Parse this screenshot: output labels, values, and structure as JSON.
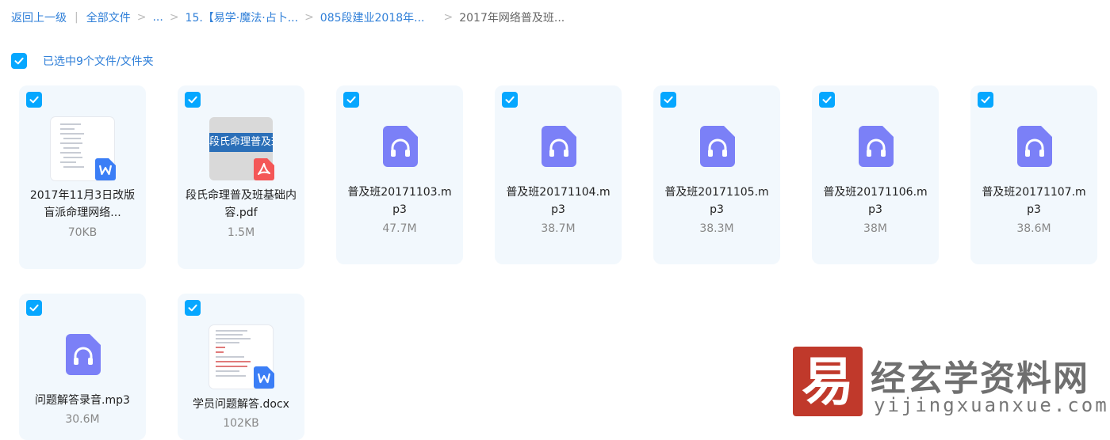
{
  "breadcrumb": {
    "back": "返回上一级",
    "sep_bar": "|",
    "sep": ">",
    "all_files": "全部文件",
    "ellipsis": "...",
    "level1": "15.【易学·魔法·占卜...",
    "level2": "085段建业2018年...",
    "current": "2017年网络普及班..."
  },
  "selection": {
    "label": "已选中9个文件/文件夹"
  },
  "colors": {
    "accent": "#06a7ff",
    "link": "#2f7fd8",
    "card_bg": "#f2f8fd",
    "audio_icon": "#7b80f7",
    "word_badge": "#3b7ef6",
    "pdf_badge": "#f45757"
  },
  "files": [
    {
      "name": "2017年11月3日改版盲派命理网络...",
      "size": "70KB",
      "kind": "doc",
      "icon": "word-icon",
      "checked": true
    },
    {
      "name": "段氏命理普及班基础内容.pdf",
      "size": "1.5M",
      "kind": "pdf",
      "icon": "pdf-icon",
      "thumb_text": "段氏命理普及班",
      "checked": true
    },
    {
      "name": "普及班20171103.mp3",
      "size": "47.7M",
      "kind": "audio",
      "icon": "headphones-icon",
      "checked": true
    },
    {
      "name": "普及班20171104.mp3",
      "size": "38.7M",
      "kind": "audio",
      "icon": "headphones-icon",
      "checked": true
    },
    {
      "name": "普及班20171105.mp3",
      "size": "38.3M",
      "kind": "audio",
      "icon": "headphones-icon",
      "checked": true
    },
    {
      "name": "普及班20171106.mp3",
      "size": "38M",
      "kind": "audio",
      "icon": "headphones-icon",
      "checked": true
    },
    {
      "name": "普及班20171107.mp3",
      "size": "38.6M",
      "kind": "audio",
      "icon": "headphones-icon",
      "checked": true
    },
    {
      "name": "问题解答录音.mp3",
      "size": "30.6M",
      "kind": "audio",
      "icon": "headphones-icon",
      "checked": true
    },
    {
      "name": "学员问题解答.docx",
      "size": "102KB",
      "kind": "doc",
      "icon": "word-icon",
      "checked": true
    }
  ],
  "watermark": {
    "seal_char": "易",
    "title": "经玄学资料网",
    "url": "yijingxuanxue.com"
  }
}
